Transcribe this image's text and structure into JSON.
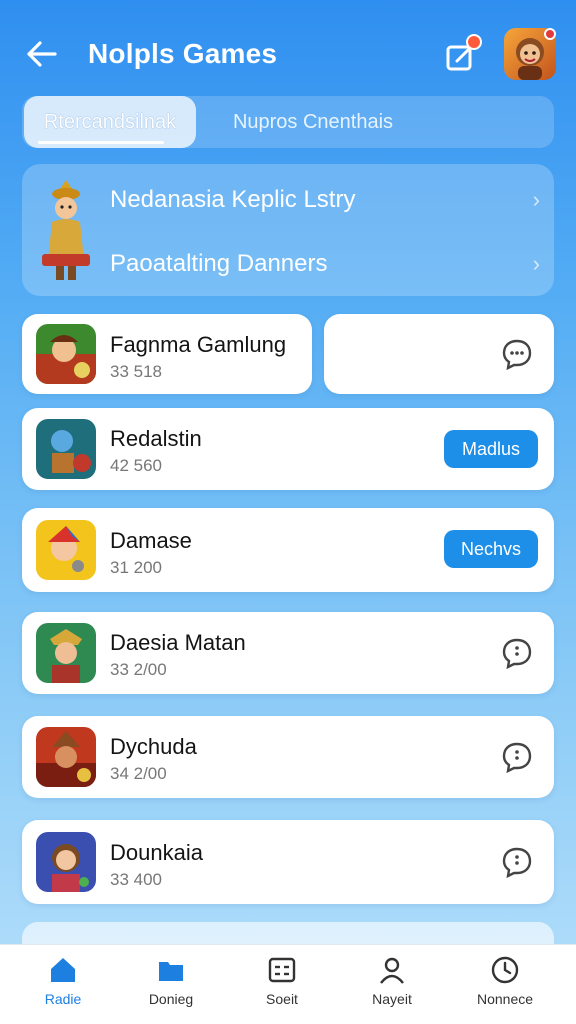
{
  "header": {
    "title": "Nolpls Games",
    "back_icon": "back-arrow-icon",
    "edit_icon": "edit-share-icon",
    "avatar": "profile-avatar"
  },
  "tabs": [
    {
      "label": "Rtercandsilnak",
      "active": true
    },
    {
      "label": "Nupros Cnenthais",
      "active": false
    }
  ],
  "featured": {
    "rows": [
      {
        "label": "Nedanasia Keplic Lstry"
      },
      {
        "label": "Paoatalting Danners"
      }
    ]
  },
  "games": [
    {
      "name": "Fagnma Gamlung",
      "sub": "33 518",
      "action": "chat"
    },
    {
      "name": "Redalstin",
      "sub": "42 560",
      "action": "button",
      "action_label": "Madlus"
    },
    {
      "name": "Damase",
      "sub": "31 200",
      "action": "button",
      "action_label": "Nechvs"
    },
    {
      "name": "Daesia Matan",
      "sub": "33 2/00",
      "action": "chat"
    },
    {
      "name": "Dychuda",
      "sub": "34 2/00",
      "action": "chat"
    },
    {
      "name": "Dounkaia",
      "sub": "33 400",
      "action": "chat"
    }
  ],
  "nav": [
    {
      "label": "Radie",
      "icon": "home-icon",
      "active": true
    },
    {
      "label": "Donieg",
      "icon": "folder-icon",
      "active": false
    },
    {
      "label": "Soeit",
      "icon": "list-icon",
      "active": false
    },
    {
      "label": "Nayeit",
      "icon": "person-icon",
      "active": false
    },
    {
      "label": "Nonnece",
      "icon": "clock-icon",
      "active": false
    }
  ],
  "colors": {
    "accent": "#1d8fe8",
    "header_bg": "#2f8ff0",
    "notification": "#ff5a3c"
  }
}
